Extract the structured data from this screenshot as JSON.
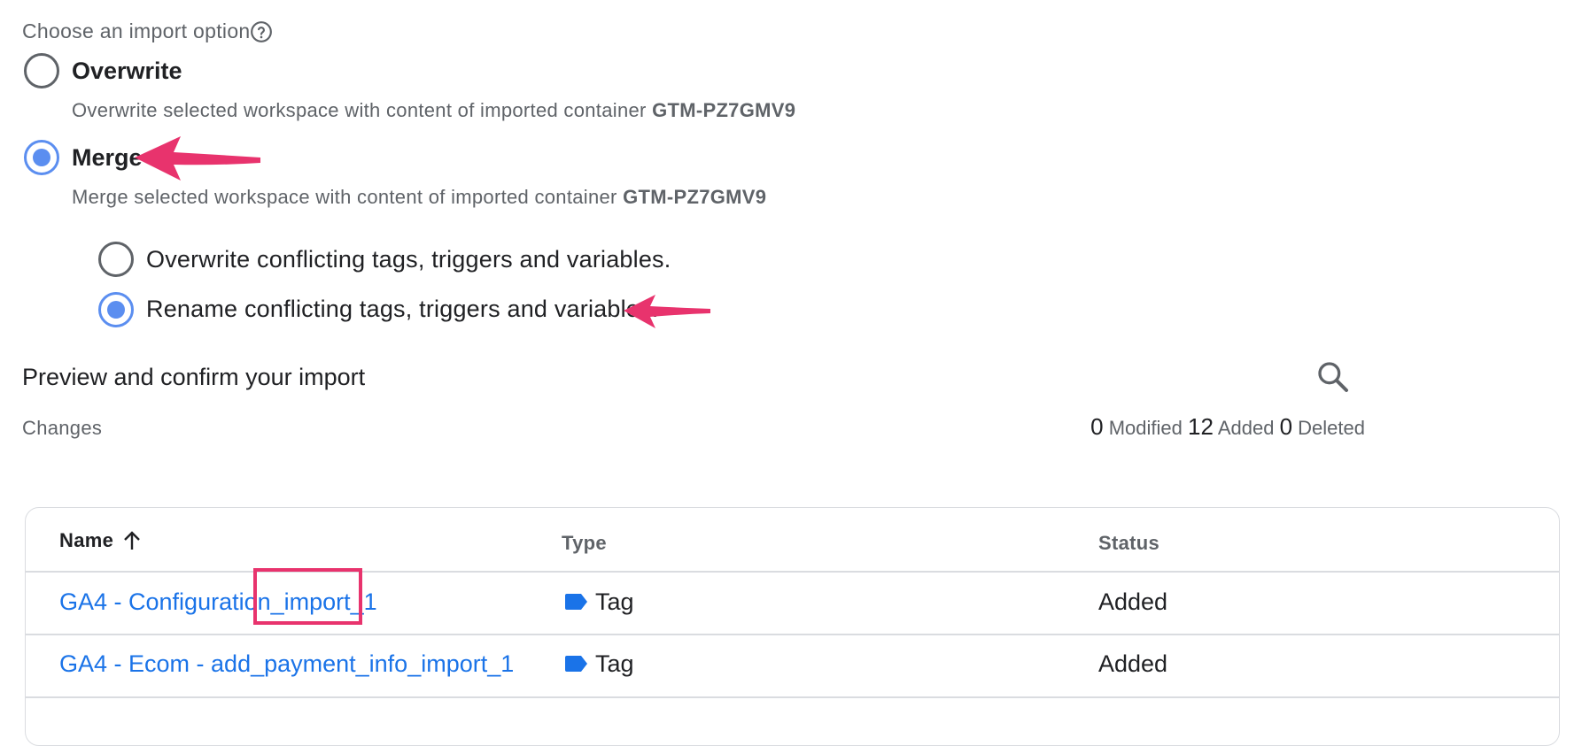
{
  "import_option": {
    "label": "Choose an import option",
    "options": [
      {
        "title": "Overwrite",
        "description": "Overwrite selected workspace with content of imported container",
        "container_id": "GTM-PZ7GMV9",
        "selected": false
      },
      {
        "title": "Merge",
        "description": "Merge selected workspace with content of imported container",
        "container_id": "GTM-PZ7GMV9",
        "selected": true
      }
    ],
    "merge_options": [
      {
        "label": "Overwrite conflicting tags, triggers and variables.",
        "selected": false
      },
      {
        "label": "Rename conflicting tags, triggers and variables.",
        "selected": true
      }
    ]
  },
  "preview": {
    "title": "Preview and confirm your import",
    "changes_label": "Changes",
    "summary": {
      "modified_count": "0",
      "modified_label": "Modified",
      "added_count": "12",
      "added_label": "Added",
      "deleted_count": "0",
      "deleted_label": "Deleted"
    },
    "table": {
      "columns": {
        "name": "Name",
        "type": "Type",
        "status": "Status"
      },
      "rows": [
        {
          "name": "GA4 - Configuration_import_1",
          "type": "Tag",
          "status": "Added"
        },
        {
          "name": "GA4 - Ecom - add_payment_info_import_1",
          "type": "Tag",
          "status": "Added"
        }
      ]
    }
  },
  "annotation_color": "#e8336d",
  "accent_color": "#1a73e8"
}
